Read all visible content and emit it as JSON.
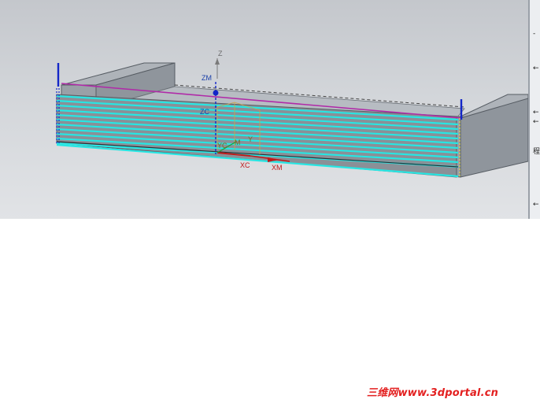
{
  "viewport": {
    "axis_labels": {
      "z": "Z",
      "zm": "ZM",
      "zc": "ZC",
      "yc": "YC",
      "m": "M",
      "y": "Y",
      "xc": "XC",
      "xm": "XM"
    }
  },
  "side_panel": {
    "glyphs": [
      "-",
      "←",
      "←",
      "←",
      "程",
      "←"
    ]
  },
  "watermark": "三维网www.3dportal.cn",
  "colors": {
    "toolpath": "#27e6e3",
    "profile": "#b02aa8",
    "tool_axis": "#1326c8",
    "background_top": "#c4c7cc",
    "background_bottom": "#e1e3e6",
    "watermark": "#e32020"
  }
}
